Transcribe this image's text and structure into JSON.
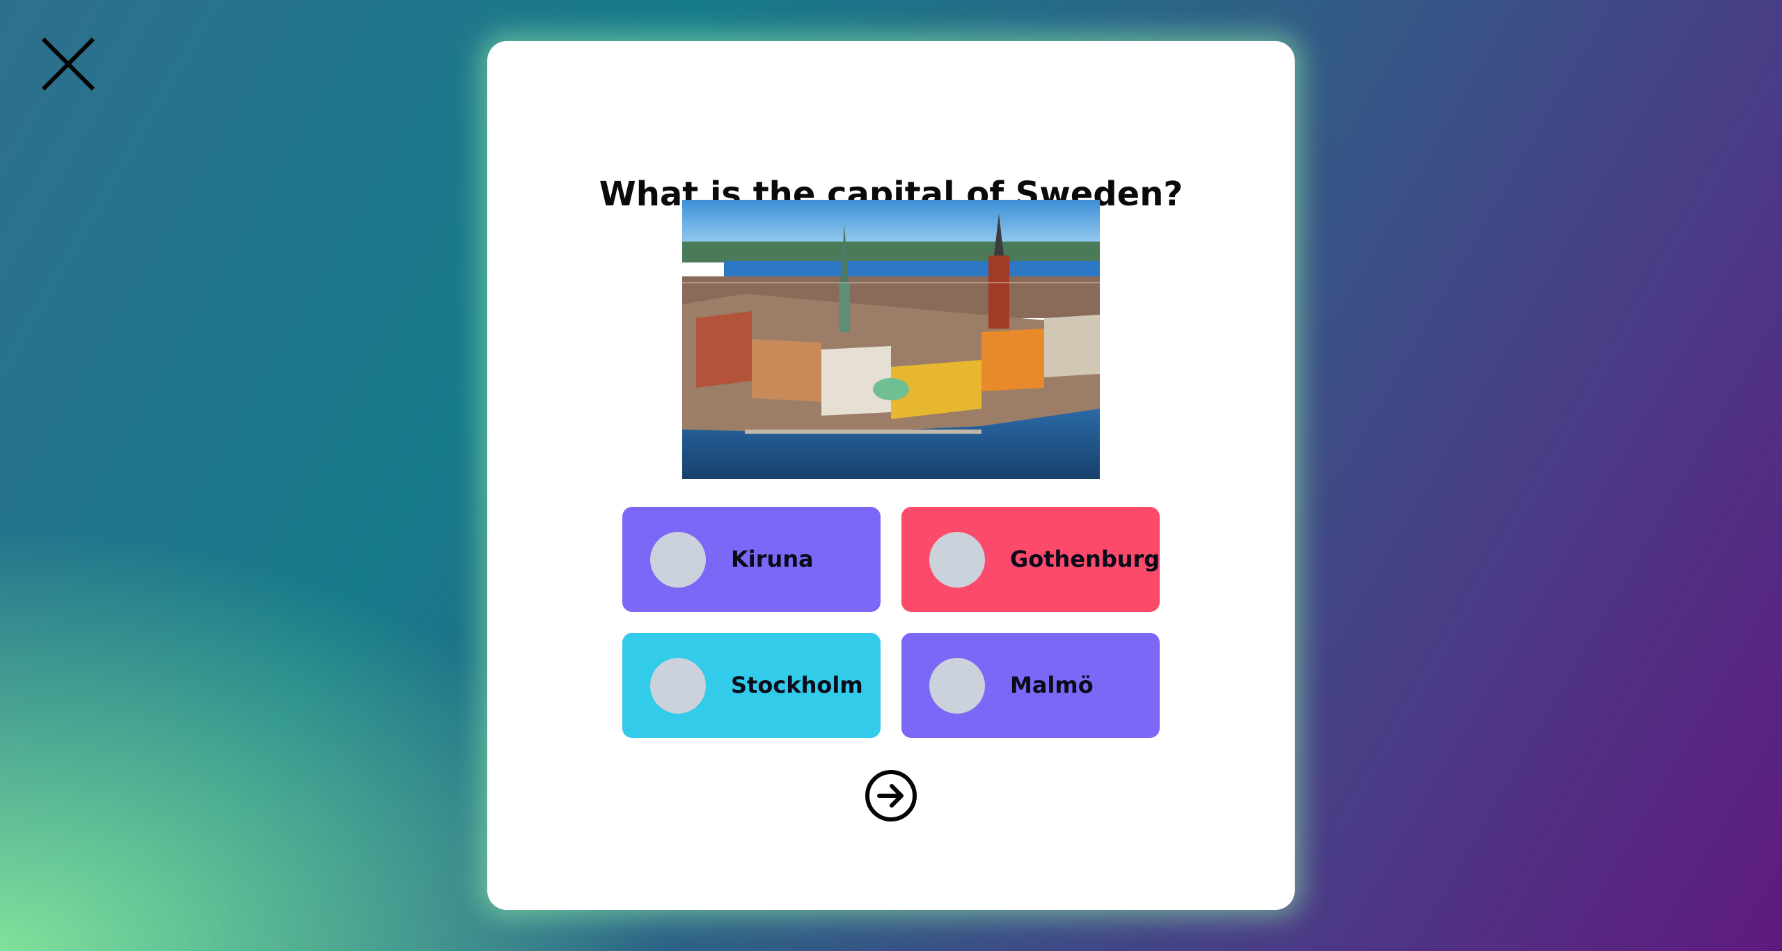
{
  "close": {
    "icon": "close-icon"
  },
  "quiz": {
    "question": "What is the capital of Sweden?",
    "image": {
      "subject": "Stockholm old town aerial cityscape"
    },
    "answers": [
      {
        "label": "Kiruna",
        "color": "#7b68f7"
      },
      {
        "label": "Gothenburg",
        "color": "#fc4a6a"
      },
      {
        "label": "Stockholm",
        "color": "#33cbea"
      },
      {
        "label": "Malmö",
        "color": "#7b68f7"
      }
    ],
    "next": {
      "icon": "arrow-right-circle-icon"
    }
  },
  "colors": {
    "card": "#ffffff",
    "radio": "#cbd2dc",
    "text": "#0b0b1a"
  }
}
